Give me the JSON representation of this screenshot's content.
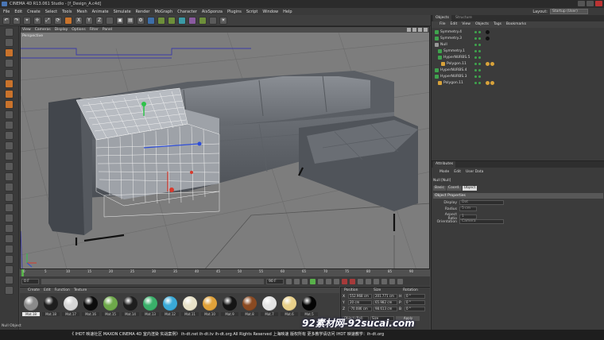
{
  "title_bar": {
    "text": "CINEMA 4D R13.061 Studio - [f_Design_A.c4d]"
  },
  "menu": [
    "File",
    "Edit",
    "Create",
    "Select",
    "Tools",
    "Mesh",
    "Animate",
    "Simulate",
    "Render",
    "MoGraph",
    "Character",
    "AixSponza",
    "Plugins",
    "Script",
    "Window",
    "Help"
  ],
  "layout": {
    "label": "Layout:",
    "value": "Startup (User)"
  },
  "viewport": {
    "menu": [
      "View",
      "Cameras",
      "Display",
      "Options",
      "Filter",
      "Panel"
    ],
    "label": "Perspective"
  },
  "timeline": {
    "ticks": [
      "0",
      "5",
      "10",
      "15",
      "20",
      "25",
      "30",
      "35",
      "40",
      "45",
      "50",
      "55",
      "60",
      "65",
      "70",
      "75",
      "80",
      "85",
      "90"
    ],
    "start": "0 F",
    "end": "90 F",
    "current": "0 F",
    "right_value": "90 F"
  },
  "materials": {
    "menu": [
      "Create",
      "Edit",
      "Function",
      "Texture"
    ],
    "items": [
      {
        "label": "Mat.18",
        "color": "#8a8a8a",
        "selected": true
      },
      {
        "label": "Mat.18",
        "color": "#1e1e1e"
      },
      {
        "label": "Mat.17",
        "color": "#d6d6d6"
      },
      {
        "label": "Mat.16",
        "color": "#0c0c0c"
      },
      {
        "label": "Mat.15",
        "color": "#6ea84a"
      },
      {
        "label": "Mat.14",
        "color": "#1e1e1e"
      },
      {
        "label": "Mat.13",
        "color": "#3ab06a"
      },
      {
        "label": "Mat.12",
        "color": "#3aaad8"
      },
      {
        "label": "Mat.11",
        "color": "#e8e2c8"
      },
      {
        "label": "Mat.10",
        "color": "#e0a23a"
      },
      {
        "label": "Mat.9",
        "color": "#151515"
      },
      {
        "label": "Mat.8",
        "color": "#8a4a22"
      },
      {
        "label": "Mat.7",
        "color": "#e4e4e4"
      },
      {
        "label": "Mat.6",
        "color": "#e8d08a"
      },
      {
        "label": "Mat.5",
        "color": "#050505"
      }
    ]
  },
  "coordinates": {
    "headers": [
      "Position",
      "Size",
      "Rotation"
    ],
    "rows": [
      {
        "axis": "X",
        "pos": "552.968 cm",
        "size": "201.771 cm",
        "rot_axis": "H",
        "rot": "0 °"
      },
      {
        "axis": "Y",
        "pos": "20 cm",
        "size": "65.982 cm",
        "rot_axis": "P",
        "rot": "0 °"
      },
      {
        "axis": "Z",
        "pos": "-70.086 cm",
        "size": "98.613 cm",
        "rot_axis": "B",
        "rot": "0 °"
      }
    ],
    "mode": "Object (Rel)",
    "size_mode": "Size",
    "apply": "Apply"
  },
  "objects_panel": {
    "tabs": [
      "Objects",
      "Structure"
    ],
    "menu": [
      "File",
      "Edit",
      "View",
      "Objects",
      "Tags",
      "Bookmarks"
    ],
    "rows": [
      {
        "name": "Symmetry.4",
        "indent": 1,
        "tags": 2
      },
      {
        "name": "Symmetry.3",
        "indent": 1,
        "tags": 2
      },
      {
        "name": "Null",
        "indent": 1,
        "tags": 0
      },
      {
        "name": "Symmetry.1",
        "indent": 2,
        "tags": 0
      },
      {
        "name": "HyperNURBS.5",
        "indent": 2,
        "tags": 0
      },
      {
        "name": "Polygon.11",
        "indent": 3,
        "tags": 1
      },
      {
        "name": "HyperNURBS.4",
        "indent": 1,
        "tags": 0
      },
      {
        "name": "HyperNURBS.3",
        "indent": 1,
        "tags": 0
      },
      {
        "name": "Polygon.11",
        "indent": 2,
        "tags": 1
      }
    ]
  },
  "attributes_panel": {
    "tab": "Attributes",
    "mode_menu": [
      "Mode",
      "Edit",
      "User Data"
    ],
    "object_label": "Null [Null]",
    "buttons": [
      "Basic",
      "Coord.",
      "Object"
    ],
    "section": "Object Properties",
    "props": [
      {
        "label": "Display",
        "value": "Dot"
      },
      {
        "label": "Radius",
        "value": "5 cm"
      },
      {
        "label": "Aspect Ratio",
        "value": "1"
      },
      {
        "label": "Orientation",
        "value": "Camera"
      }
    ]
  },
  "status_left": "Null Object",
  "status_bar": "《 IHDT 映速社区 MAXON CINEMA 4D 室内渲染 实战案例》 ih-dt.net ih-dt.tv ih-dt.org All Rights Reserved 上海映速 版权所有 更多教学请访问 IHDT 映速教学：ih-dt.org",
  "watermark": "92素材网-92sucai.com"
}
